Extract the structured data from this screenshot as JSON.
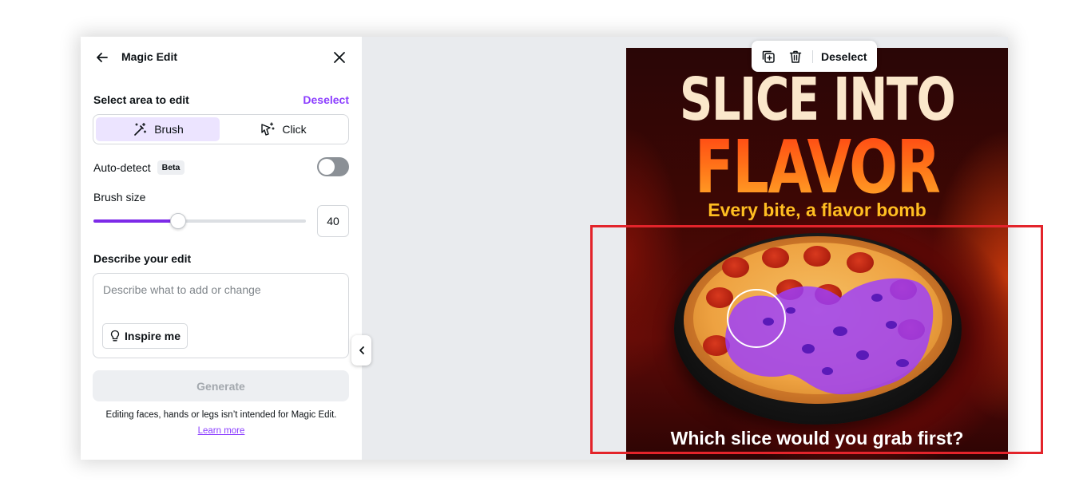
{
  "panel": {
    "title": "Magic Edit",
    "back_icon": "arrow-left-icon",
    "close_icon": "close-icon",
    "select_area_label": "Select area to edit",
    "deselect_label": "Deselect",
    "modes": [
      {
        "label": "Brush",
        "icon": "magic-brush-icon",
        "active": true
      },
      {
        "label": "Click",
        "icon": "magic-click-icon",
        "active": false
      }
    ],
    "auto_detect_label": "Auto-detect",
    "beta_badge": "Beta",
    "auto_detect_on": false,
    "brush_size_label": "Brush size",
    "brush_size_value": "40",
    "brush_size_fraction": 0.4,
    "describe_label": "Describe your edit",
    "describe_placeholder": "Describe what to add or change",
    "inspire_label": "Inspire me",
    "generate_label": "Generate",
    "note": "Editing faces, hands or legs isn’t intended for Magic Edit.",
    "learn_more": "Learn more"
  },
  "toolbar": {
    "duplicate_icon": "duplicate-icon",
    "delete_icon": "trash-icon",
    "deselect_label": "Deselect"
  },
  "poster": {
    "title_line1": "SLICE INTO",
    "title_line2": "FLAVOR",
    "subtitle": "Every bite, a flavor bomb",
    "question": "Which slice would you grab first?"
  },
  "colors": {
    "accent": "#8b3dff",
    "slider_fill": "#7d2ae8",
    "active_segment": "#ece4ff",
    "brush_mask": "#9b3dff",
    "highlight_box": "#e3242b"
  }
}
